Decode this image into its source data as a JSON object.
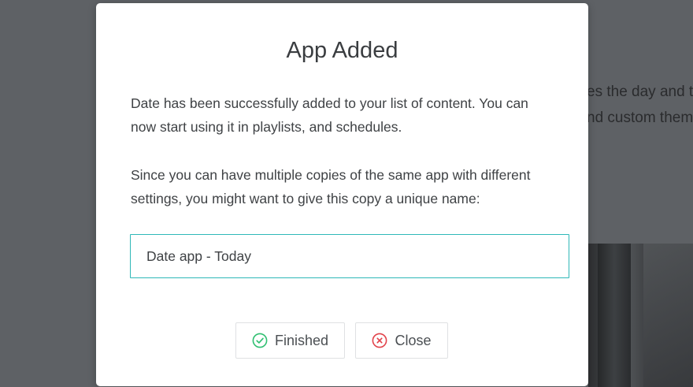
{
  "background": {
    "text_line1": "es the day and t",
    "text_line2": "nd custom them"
  },
  "modal": {
    "title": "App Added",
    "paragraph1": "Date has been successfully added to your list of content. You can now start using it in playlists, and schedules.",
    "paragraph2": "Since you can have multiple copies of the same app with different settings, you might want to give this copy a unique name:",
    "name_input_value": "Date app - Today",
    "finished_label": "Finished",
    "close_label": "Close"
  },
  "colors": {
    "accent": "#2fb8b8",
    "finished_icon": "#2fbf71",
    "close_icon": "#e2424a"
  },
  "icons": {
    "finished": "check-circle-icon",
    "close": "x-circle-icon"
  }
}
